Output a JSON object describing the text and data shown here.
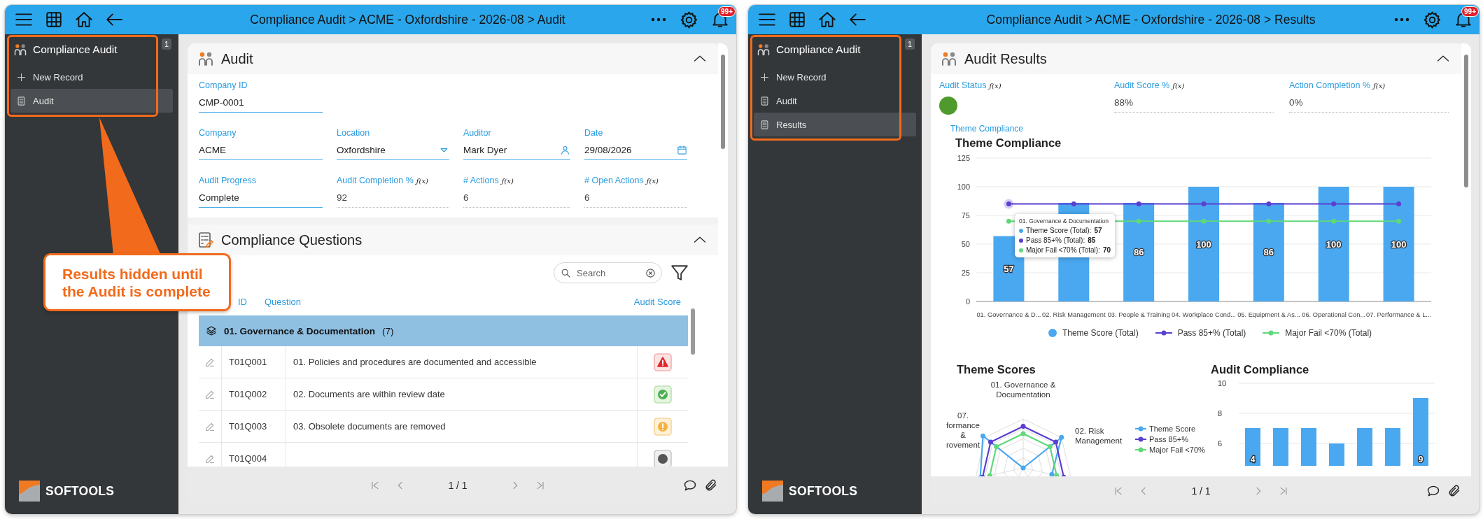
{
  "windows": [
    {
      "kind": "audit",
      "breadcrumb": "Compliance Audit > ACME - Oxfordshire - 2026-08 > Audit",
      "notification_count": "99+",
      "sidebar": {
        "title": "Compliance Audit",
        "count": "1",
        "highlighted": true,
        "items": [
          {
            "label": "New Record",
            "kind": "add",
            "selected": false
          },
          {
            "label": "Audit",
            "kind": "record",
            "selected": true
          }
        ]
      },
      "brand": "SOFTOOLS",
      "sections": [
        {
          "kind": "form",
          "title": "Audit",
          "expanded": true,
          "field_rows": [
            [
              {
                "label": "Company ID",
                "value": "CMP-0001",
                "kind": "text"
              }
            ],
            [
              {
                "label": "Company",
                "value": "ACME",
                "kind": "text"
              },
              {
                "label": "Location",
                "value": "Oxfordshire",
                "kind": "dropdown"
              },
              {
                "label": "Auditor",
                "value": "Mark Dyer",
                "kind": "person"
              },
              {
                "label": "Date",
                "value": "29/08/2026",
                "kind": "date"
              }
            ],
            [
              {
                "label": "Audit Progress",
                "value": "Complete",
                "kind": "text"
              },
              {
                "label": "Audit Completion %",
                "formula_mark": "ƒ(x)",
                "value": "92",
                "kind": "formula"
              },
              {
                "label": "# Actions",
                "formula_mark": "ƒ(x)",
                "value": "6",
                "kind": "formula"
              },
              {
                "label": "# Open Actions",
                "formula_mark": "ƒ(x)",
                "value": "6",
                "kind": "formula"
              }
            ]
          ]
        },
        {
          "kind": "table",
          "title": "Compliance Questions",
          "expanded": true,
          "search": {
            "placeholder": "Search"
          },
          "columns": [
            "ID",
            "Question",
            "Audit Score"
          ],
          "group": {
            "label": "01. Governance & Documentation",
            "count": "(7)"
          },
          "rows": [
            {
              "id": "T01Q001",
              "question": "01. Policies and procedures are documented and accessible",
              "kind": "fail"
            },
            {
              "id": "T01Q002",
              "question": "02. Documents are within review date",
              "kind": "pass"
            },
            {
              "id": "T01Q003",
              "question": "03. Obsolete documents are removed",
              "kind": "warning"
            },
            {
              "id": "T01Q004",
              "kind": "neutral"
            }
          ]
        }
      ],
      "pager": "1 / 1"
    },
    {
      "kind": "results",
      "breadcrumb": "Compliance Audit > ACME - Oxfordshire - 2026-08 > Results",
      "notification_count": "99+",
      "sidebar": {
        "title": "Compliance Audit",
        "count": "1",
        "highlighted": true,
        "items": [
          {
            "label": "New Record",
            "kind": "add",
            "selected": false
          },
          {
            "label": "Audit",
            "kind": "record",
            "selected": false
          },
          {
            "label": "Results",
            "kind": "record",
            "selected": true
          }
        ]
      },
      "brand": "SOFTOOLS",
      "sections": [
        {
          "kind": "results",
          "title": "Audit Results",
          "expanded": true,
          "fields": [
            {
              "label": "Audit Status",
              "formula_mark": "ƒ(x)",
              "kind": "status",
              "color": "#4f9a2c"
            },
            {
              "label": "Audit Score %",
              "formula_mark": "ƒ(x)",
              "value": "88%",
              "kind": "formula"
            },
            {
              "label": "Action Completion %",
              "formula_mark": "ƒ(x)",
              "value": "0%",
              "kind": "formula"
            }
          ],
          "chart_label": "Theme Compliance",
          "charts": [
            {
              "kind": "combo",
              "chart_data": {
                "type": "bar",
                "title": "Theme Compliance",
                "categories": [
                  "01. Governance & D...",
                  "02. Risk Management",
                  "03. People & Training",
                  "04. Workplace Cond...",
                  "05. Equipment & As...",
                  "06. Operational Con...",
                  "07. Performance & L..."
                ],
                "series": [
                  {
                    "name": "Theme Score (Total)",
                    "type": "bar",
                    "color": "#4aa8f0",
                    "values": [
                      57,
                      86,
                      86,
                      100,
                      86,
                      100,
                      100
                    ]
                  },
                  {
                    "name": "Pass 85+% (Total)",
                    "type": "line",
                    "marker": "circle",
                    "color": "#5a3fd0",
                    "values": [
                      85,
                      85,
                      85,
                      85,
                      85,
                      85,
                      85
                    ]
                  },
                  {
                    "name": "Major Fail <70% (Total)",
                    "type": "line",
                    "marker": "circle",
                    "color": "#5fd87a",
                    "values": [
                      70,
                      null,
                      70,
                      70,
                      70,
                      70,
                      70
                    ]
                  }
                ],
                "grid": true,
                "ylim": [
                  0,
                  125
                ],
                "yticks": [
                  0,
                  25,
                  50,
                  75,
                  100,
                  125
                ],
                "value_labels": [
                  "57",
                  null,
                  "86",
                  "100",
                  "86",
                  "100",
                  "100"
                ]
              },
              "tooltip": {
                "title": "01. Governance & Documentation",
                "rows": [
                  {
                    "label": "Theme Score (Total):",
                    "value": "57",
                    "color": "#4aa8f0"
                  },
                  {
                    "label": "Pass 85+% (Total):",
                    "value": "85",
                    "color": "#5a3fd0"
                  },
                  {
                    "label": "Major Fail <70% (Total):",
                    "value": "70",
                    "color": "#5fd87a"
                  }
                ]
              }
            },
            {
              "kind": "radar",
              "title": "Theme Scores",
              "axis_labels": [
                "07. formance & rovement",
                "01. Governance & Documentation",
                "02. Risk Management"
              ],
              "legend": [
                {
                  "label": "Theme Score",
                  "color": "#4aa8f0"
                },
                {
                  "label": "Pass 85+%",
                  "color": "#5a3fd0"
                },
                {
                  "label": "Major Fail <70%",
                  "color": "#5fd87a"
                }
              ]
            },
            {
              "kind": "bar",
              "title": "Audit Compliance",
              "tick_labels": [
                "10",
                "8",
                "6"
              ],
              "first_bar_label": "4",
              "last_bar_label": "9"
            }
          ]
        }
      ],
      "pager": "1 / 1"
    }
  ],
  "callout": {
    "text": "Results hidden until the Audit is complete"
  }
}
